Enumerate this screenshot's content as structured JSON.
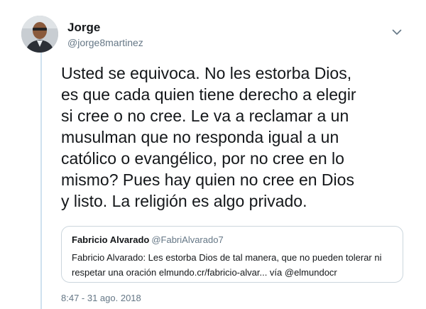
{
  "tweet": {
    "author": {
      "display_name": "Jorge",
      "handle": "@jorge8martinez"
    },
    "text": "Usted se equivoca. No les estorba Dios,\nes que cada quien tiene derecho a elegir\nsi cree o no cree. Le va a reclamar a un\nmusulman que no responda igual a un\ncatólico o evangélico, por no cree en lo\nmismo? Pues hay quien no cree en Dios\ny listo. La religión es algo privado.",
    "quoted_tweet": {
      "display_name": "Fabricio Alvarado",
      "handle": "@FabriAlvarado7",
      "text": "Fabricio Alvarado: Les estorba Dios de tal manera, que no pueden tolerar ni\nrespetar una oración elmundo.cr/fabricio-alvar... vía @elmundocr"
    },
    "timestamp": "8:47 - 31 ago. 2018",
    "icons": {
      "menu": "chevron-down-icon",
      "avatar": "avatar"
    }
  },
  "colors": {
    "text": "#14171a",
    "secondary": "#657786",
    "border": "#ccd6dd",
    "thread_line": "#cfe1ef"
  }
}
